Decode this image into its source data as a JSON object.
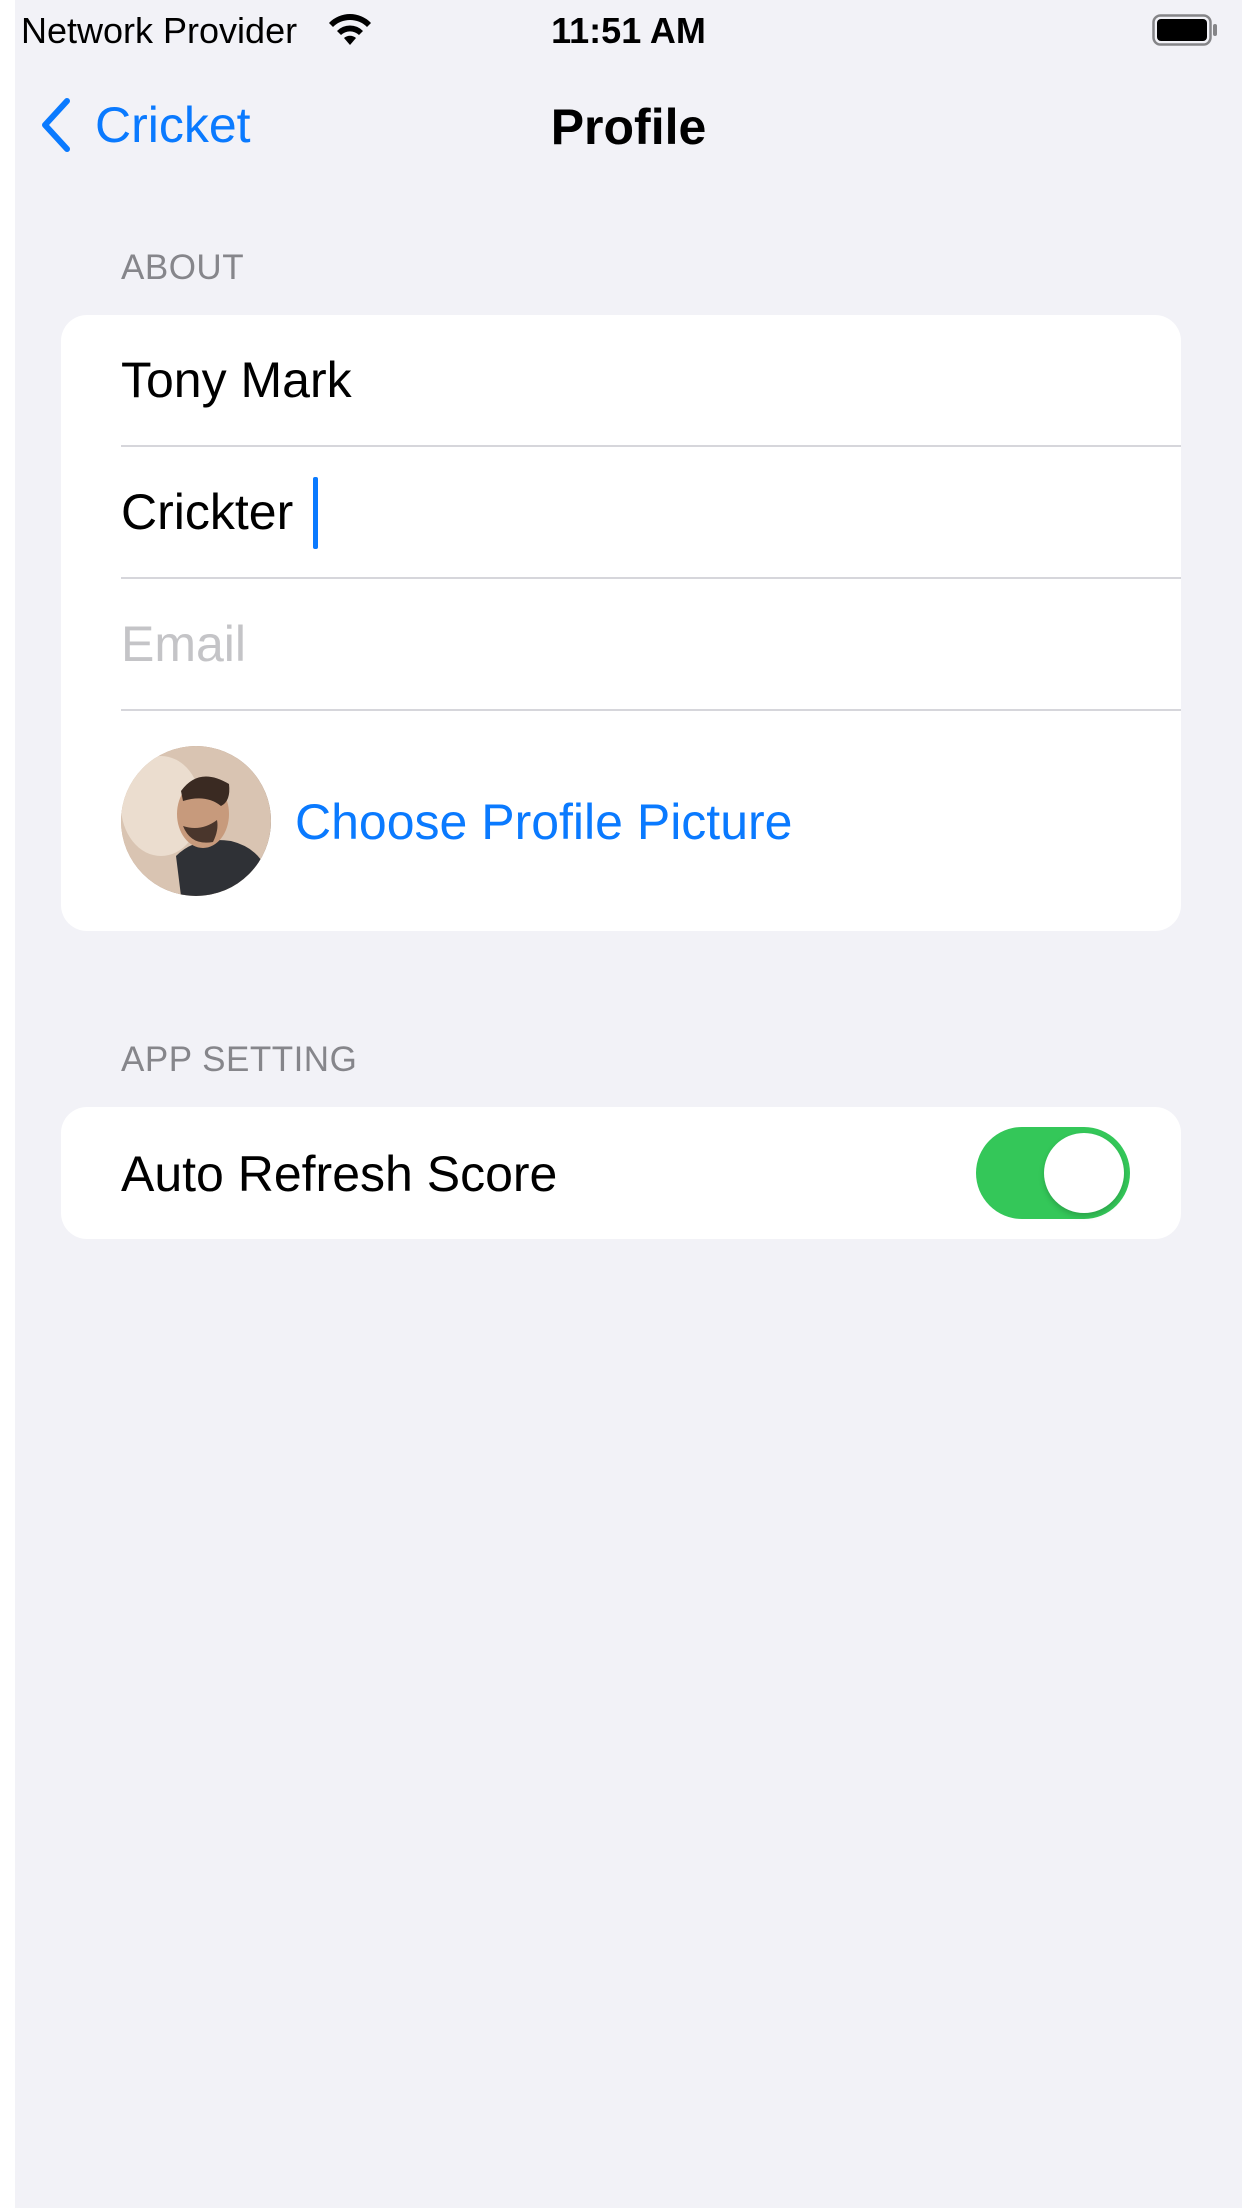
{
  "status_bar": {
    "carrier": "Network Provider",
    "time": "11:51 AM",
    "wifi_icon": "wifi-icon",
    "battery_icon": "battery-icon"
  },
  "nav": {
    "back_label": "Cricket",
    "title": "Profile"
  },
  "about": {
    "header": "ABOUT",
    "name_value": "Tony Mark",
    "role_value": "Crickter",
    "email_placeholder": "Email",
    "email_value": "",
    "choose_picture_label": "Choose Profile Picture"
  },
  "app_setting": {
    "header": "APP SETTING",
    "auto_refresh_label": "Auto Refresh Score",
    "auto_refresh_enabled": true
  },
  "colors": {
    "accent": "#0a7aff",
    "toggle_on": "#34c759",
    "background": "#f2f2f7"
  }
}
